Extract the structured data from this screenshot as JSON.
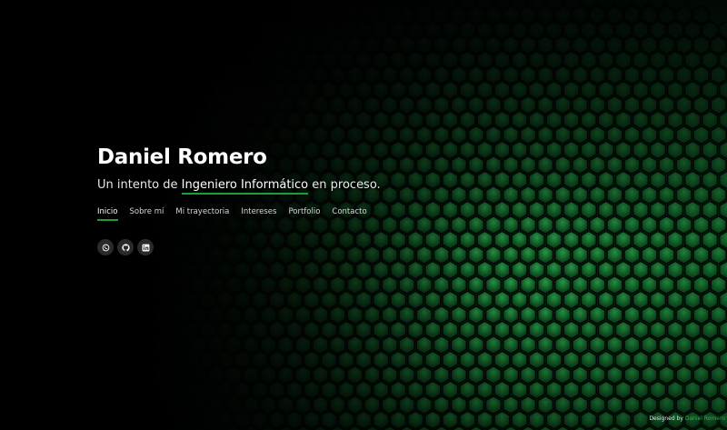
{
  "hero": {
    "name": "Daniel Romero",
    "tagline_prefix": "Un intento de",
    "tagline_highlight": "Ingeniero Informático",
    "tagline_suffix": "en proceso."
  },
  "nav": {
    "items": [
      {
        "label": "Inicio",
        "active": true
      },
      {
        "label": "Sobre mí",
        "active": false
      },
      {
        "label": "Mi trayectoria",
        "active": false
      },
      {
        "label": "Intereses",
        "active": false
      },
      {
        "label": "Portfolio",
        "active": false
      },
      {
        "label": "Contacto",
        "active": false
      }
    ]
  },
  "social": {
    "items": [
      {
        "icon": "whatsapp-icon"
      },
      {
        "icon": "github-icon"
      },
      {
        "icon": "linkedin-icon"
      }
    ]
  },
  "footer": {
    "prefix": "Designed by",
    "author": "Daniel Romero"
  },
  "colors": {
    "accent": "#1f9d3a",
    "background": "#000000",
    "text": "#ffffff"
  }
}
